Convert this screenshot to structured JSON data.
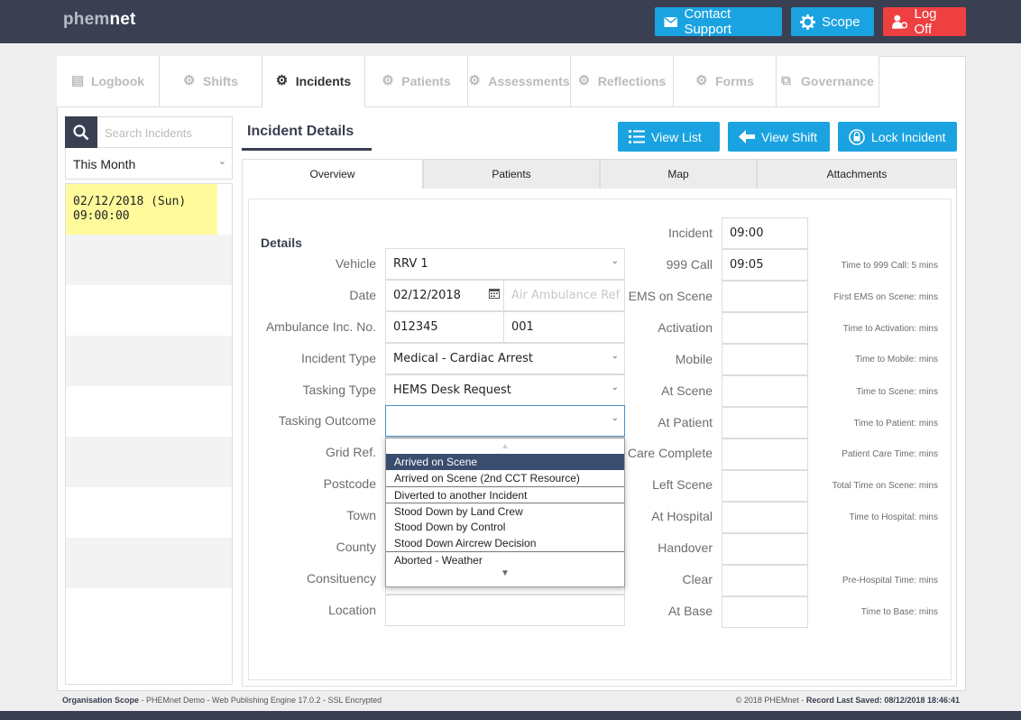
{
  "app": {
    "logo_light": "phem",
    "logo_bold": "net"
  },
  "topbar": {
    "contact_label": "Contact Support",
    "scope_label": "Scope",
    "logoff_label": "Log Off"
  },
  "nav": [
    {
      "label": "Logbook",
      "icon": "book-icon"
    },
    {
      "label": "Shifts",
      "icon": "gear-user-icon"
    },
    {
      "label": "Incidents",
      "icon": "gear-user-icon",
      "active": true
    },
    {
      "label": "Patients",
      "icon": "gear-user-icon"
    },
    {
      "label": "Assessments",
      "icon": "gear-user-icon"
    },
    {
      "label": "Reflections",
      "icon": "gear-user-icon"
    },
    {
      "label": "Forms",
      "icon": "gear-user-icon"
    },
    {
      "label": "Governance",
      "icon": "copy-icon"
    }
  ],
  "sidebar": {
    "search_placeholder": "Search Incidents",
    "period": "This Month",
    "selected_date": "02/12/2018 (Sun)",
    "selected_time": "09:00:00"
  },
  "header": {
    "title": "Incident Details",
    "view_list": "View List",
    "view_shift": "View Shift",
    "lock_incident": "Lock Incident"
  },
  "subtabs": [
    "Overview",
    "Patients",
    "Map",
    "Attachments"
  ],
  "details": {
    "title": "Details",
    "vehicle_label": "Vehicle",
    "vehicle_value": "RRV 1",
    "date_label": "Date",
    "date_value": "02/12/2018",
    "air_ambulance_placeholder": "Air Ambulance Ref",
    "amb_label": "Ambulance Inc. No.",
    "amb_value1": "012345",
    "amb_value2": "001",
    "type_label": "Incident Type",
    "type_value": "Medical - Cardiac Arrest",
    "tasking_type_label": "Tasking Type",
    "tasking_type_value": "HEMS Desk Request",
    "tasking_outcome_label": "Tasking Outcome",
    "grid_label": "Grid Ref.",
    "postcode_label": "Postcode",
    "town_label": "Town",
    "county_label": "County",
    "constituency_label": "Consituency",
    "location_label": "Location"
  },
  "dropdown": {
    "items": [
      "Arrived on Scene",
      "Arrived on Scene (2nd CCT Resource)",
      "Diverted to another Incident",
      "Stood Down by Land Crew",
      "Stood Down by Control",
      "Stood Down Aircrew Decision",
      "Aborted - Weather"
    ],
    "highlighted_index": 0
  },
  "times": {
    "incident_label": "Incident",
    "incident_value": "09:00",
    "call_label": "999 Call",
    "call_value": "09:05",
    "call_note": "Time to 999 Call: 5 mins",
    "ems_label": "EMS on Scene",
    "ems_note": "First EMS on Scene:  mins",
    "activation_label": "Activation",
    "activation_note": "Time to Activation:  mins",
    "mobile_label": "Mobile",
    "mobile_note": "Time to Mobile:  mins",
    "atscene_label": "At Scene",
    "atscene_note": "Time to Scene:  mins",
    "atpatient_label": "At Patient",
    "atpatient_note": "Time to Patient:  mins",
    "care_label": "Care Complete",
    "care_note": "Patient Care Time:  mins",
    "left_label": "Left Scene",
    "left_note": "Total Time on Scene:  mins",
    "hospital_label": "At Hospital",
    "hospital_note": "Time to Hospital:  mins",
    "handover_label": "Handover",
    "clear_label": "Clear",
    "clear_note": "Pre-Hospital Time:  mins",
    "base_label": "At Base",
    "base_note": "Time to Base:  mins"
  },
  "footer": {
    "left_bold": "Organisation Scope",
    "left_text": " - PHEMnet Demo - Web Publishing Engine 17.0.2 - SSL Encrypted",
    "right_text": "© 2018 PHEMnet - ",
    "right_bold": "Record Last Saved: 08/12/2018 18:46:41"
  },
  "colors": {
    "dark": "#3a3f51",
    "accent": "#1aa3e0",
    "danger": "#ee3f41",
    "highlight": "#fffb9c"
  }
}
